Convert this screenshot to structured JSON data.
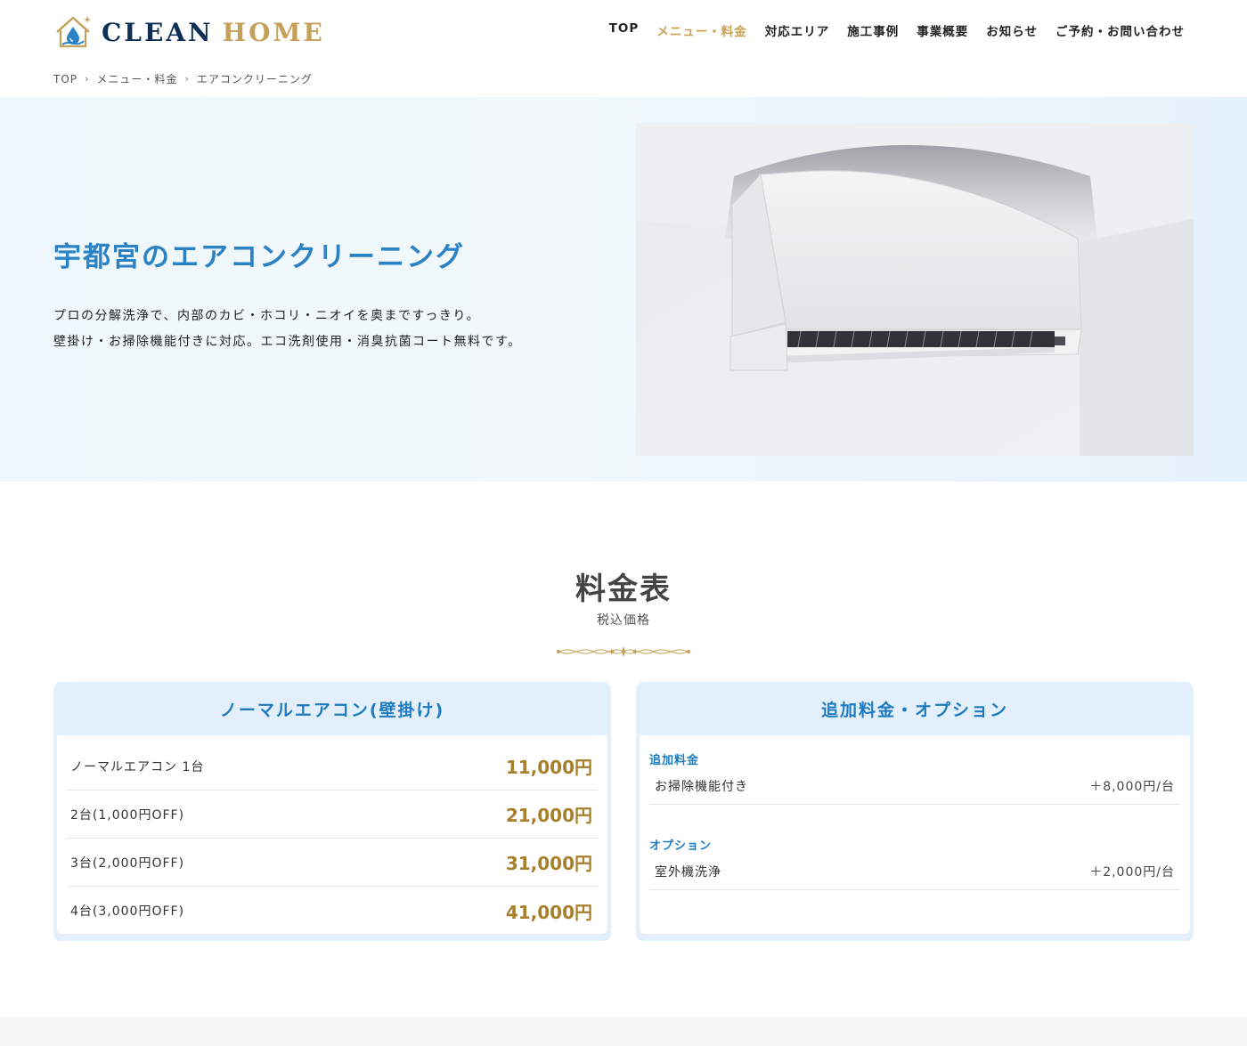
{
  "header": {
    "logo": {
      "word1": "CLEAN",
      "word2": "HOME"
    },
    "nav": [
      {
        "label": "TOP",
        "active": false
      },
      {
        "label": "メニュー・料金",
        "active": true
      },
      {
        "label": "対応エリア",
        "active": false
      },
      {
        "label": "施工事例",
        "active": false
      },
      {
        "label": "事業概要",
        "active": false
      },
      {
        "label": "お知らせ",
        "active": false
      },
      {
        "label": "ご予約・お問い合わせ",
        "active": false
      }
    ]
  },
  "breadcrumb": [
    "TOP",
    "メニュー・料金",
    "エアコンクリーニング"
  ],
  "hero": {
    "title": "宇都宮のエアコンクリーニング",
    "lines": [
      "プロの分解洗浄で、内部のカビ・ホコリ・ニオイを奥まですっきり。",
      "壁掛け・お掃除機能付きに対応。エコ洗剤使用・消臭抗菌コート無料です。"
    ]
  },
  "pricing": {
    "title": "料金表",
    "subtitle": "税込価格",
    "normal_card": {
      "title": "ノーマルエアコン(壁掛け)",
      "rows": [
        {
          "label": "ノーマルエアコン 1台",
          "price": "11,000円"
        },
        {
          "label": "2台(1,000円OFF)",
          "price": "21,000円"
        },
        {
          "label": "3台(2,000円OFF)",
          "price": "31,000円"
        },
        {
          "label": "4台(3,000円OFF)",
          "price": "41,000円"
        }
      ]
    },
    "options_card": {
      "title": "追加料金・オプション",
      "groups": [
        {
          "title": "追加料金",
          "items": [
            {
              "label": "お掃除機能付き",
              "price": "＋8,000円/台"
            }
          ]
        },
        {
          "title": "オプション",
          "items": [
            {
              "label": "室外機洗浄",
              "price": "＋2,000円/台"
            }
          ]
        }
      ]
    }
  },
  "colors": {
    "brand_navy": "#0f2f57",
    "brand_gold": "#c4a05a",
    "accent_blue": "#2b82c4",
    "price_gold": "#a8802c"
  }
}
